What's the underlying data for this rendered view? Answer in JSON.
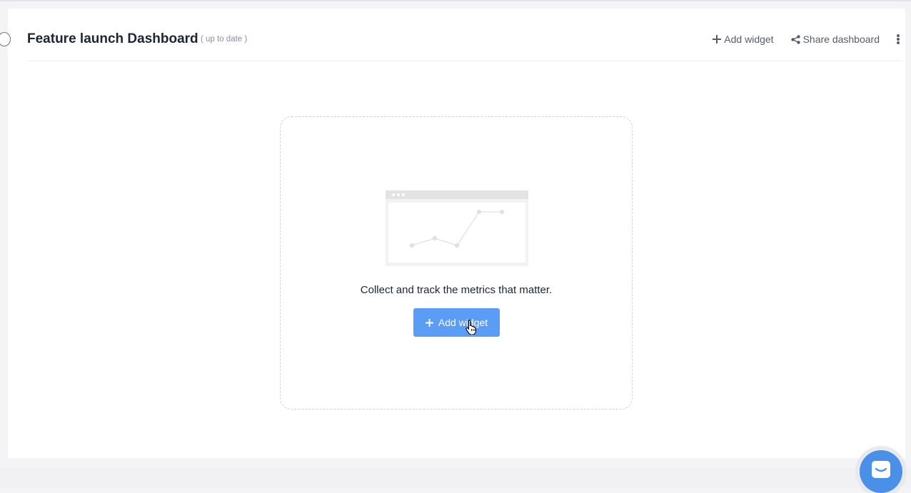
{
  "header": {
    "title": "Feature launch Dashboard",
    "status": "( up to date )",
    "actions": {
      "add_widget": "Add widget",
      "share_dashboard": "Share dashboard"
    }
  },
  "empty_state": {
    "caption": "Collect and track the metrics that matter.",
    "button_label": "Add widget"
  },
  "colors": {
    "accent": "#5b9cf6",
    "chat_launcher": "#4a90e8",
    "title_text": "#1d2433",
    "muted_text": "#8a8f9c"
  },
  "icons": {
    "add": "plus-icon",
    "share": "share-icon",
    "more": "kebab-menu-icon",
    "chat": "chat-icon",
    "cursor": "hand-pointer-icon"
  }
}
